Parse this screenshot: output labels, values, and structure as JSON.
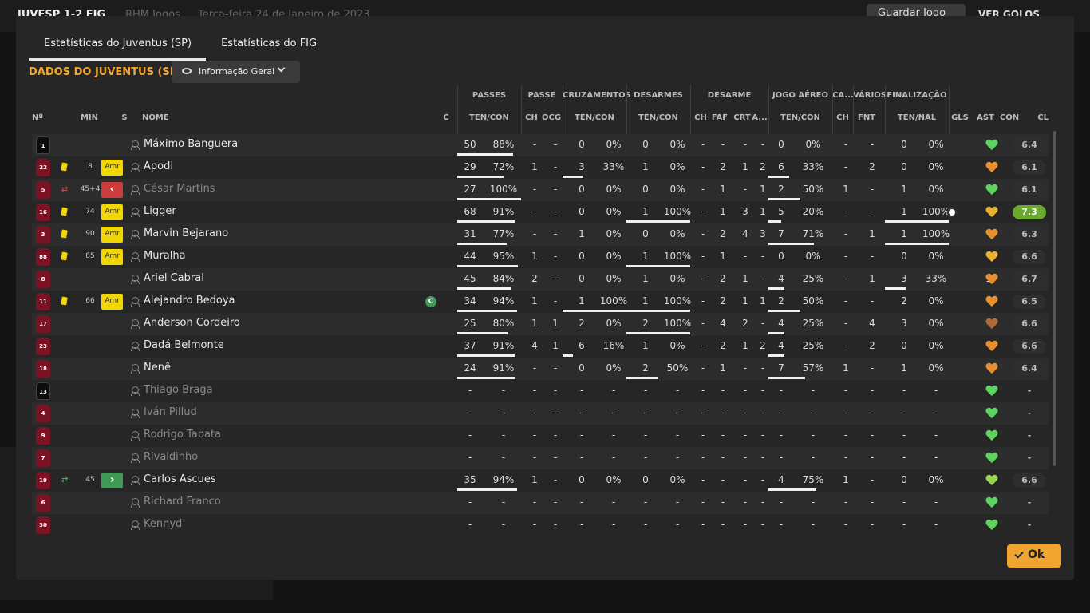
{
  "topbar": {
    "score_text": "JUVESP 1-2 FIG",
    "subtitle": "RHM Jogos",
    "date": "Terça-feira 24 de Janeiro de 2023",
    "save_label": "Guardar Jogo",
    "goals_label": "VER GOLOS"
  },
  "tabs": [
    "Estatísticas do Juventus (SP)",
    "Estatísticas do FIG"
  ],
  "team_title": "DADOS DO JUVENTUS (SP)",
  "view_selector": "Informação Geral",
  "group_headers": [
    "PASSES",
    "PASSE",
    "CRUZAMENTOS",
    "DESARMES",
    "DESARME",
    "JOGO AÉREO",
    "CA...",
    "VÁRIOS",
    "FINALIZAÇÃO"
  ],
  "column_headers": [
    "Nº",
    "MIN",
    "S",
    "NOME",
    "C",
    "TEN/CON",
    "CH",
    "OCG",
    "TEN/CON",
    "TEN/CON",
    "CH",
    "FAF",
    "CRT",
    "A...",
    "TEN/CON",
    "CH",
    "FNT",
    "TEN/NAL",
    "GLS",
    "AST",
    "CON",
    "CLA"
  ],
  "ok_label": "Ok",
  "colors": {
    "accent": "#f0a530",
    "card": "#f2d600",
    "sub_in": "#3f9a55",
    "sub_out": "#cc3c3c",
    "rating_high": "#6aa82e"
  },
  "players": [
    {
      "no": "1",
      "gk": true,
      "name": "Máximo Banguera",
      "card": false,
      "min": "",
      "sub": "",
      "s": "",
      "cap": false,
      "dim": false,
      "pas": [
        "50",
        "88%"
      ],
      "pas_pct": 88,
      "pch": "-",
      "pocg": "-",
      "cru": [
        "0",
        "0%"
      ],
      "cru_pct": 0,
      "des": [
        "0",
        "0%"
      ],
      "des_pct": 0,
      "dch": "-",
      "faf": "-",
      "crt": "-",
      "a": "-",
      "aer": [
        "0",
        "0%"
      ],
      "aer_pct": 0,
      "ca": "-",
      "fnt": "-",
      "fin": [
        "0",
        "0%"
      ],
      "fin_pct": 0,
      "gls": "",
      "ast": "-",
      "con": "#5fd35f",
      "cla": "6.4",
      "hi": false
    },
    {
      "no": "22",
      "gk": false,
      "name": "Apodi",
      "card": true,
      "min": "8",
      "sub": "",
      "s": "Amr",
      "cap": false,
      "dim": false,
      "pas": [
        "29",
        "72%"
      ],
      "pas_pct": 72,
      "pch": "1",
      "pocg": "-",
      "cru": [
        "3",
        "33%"
      ],
      "cru_pct": 33,
      "des": [
        "1",
        "0%"
      ],
      "des_pct": 0,
      "dch": "-",
      "faf": "2",
      "crt": "1",
      "a": "2",
      "aer": [
        "6",
        "33%"
      ],
      "aer_pct": 33,
      "ca": "-",
      "fnt": "2",
      "fin": [
        "0",
        "0%"
      ],
      "fin_pct": 0,
      "gls": "",
      "ast": "-",
      "con": "#e8902f",
      "cla": "6.1",
      "hi": false
    },
    {
      "no": "5",
      "gk": false,
      "name": "César Martins",
      "card": false,
      "min": "45+4",
      "sub": "out",
      "s": "<",
      "cap": false,
      "dim": true,
      "pas": [
        "27",
        "100%"
      ],
      "pas_pct": 100,
      "pch": "-",
      "pocg": "-",
      "cru": [
        "0",
        "0%"
      ],
      "cru_pct": 0,
      "des": [
        "0",
        "0%"
      ],
      "des_pct": 0,
      "dch": "-",
      "faf": "1",
      "crt": "-",
      "a": "1",
      "aer": [
        "2",
        "50%"
      ],
      "aer_pct": 50,
      "ca": "1",
      "fnt": "-",
      "fin": [
        "1",
        "0%"
      ],
      "fin_pct": 0,
      "gls": "",
      "ast": "-",
      "con": "#5fd35f",
      "cla": "6.1",
      "hi": false
    },
    {
      "no": "16",
      "gk": false,
      "name": "Ligger",
      "card": true,
      "min": "74",
      "sub": "",
      "s": "Amr",
      "cap": false,
      "dim": false,
      "pas": [
        "68",
        "91%"
      ],
      "pas_pct": 91,
      "pch": "-",
      "pocg": "-",
      "cru": [
        "0",
        "0%"
      ],
      "cru_pct": 0,
      "des": [
        "1",
        "100%"
      ],
      "des_pct": 100,
      "dch": "-",
      "faf": "1",
      "crt": "3",
      "a": "1",
      "aer": [
        "5",
        "20%"
      ],
      "aer_pct": 20,
      "ca": "-",
      "fnt": "-",
      "fin": [
        "1",
        "100%"
      ],
      "fin_pct": 100,
      "gls": "ball",
      "ast": "-",
      "con": "#e8b02f",
      "cla": "7.3",
      "hi": true
    },
    {
      "no": "3",
      "gk": false,
      "name": "Marvin Bejarano",
      "card": true,
      "min": "90",
      "sub": "",
      "s": "Amr",
      "cap": false,
      "dim": false,
      "pas": [
        "31",
        "77%"
      ],
      "pas_pct": 77,
      "pch": "-",
      "pocg": "-",
      "cru": [
        "1",
        "0%"
      ],
      "cru_pct": 0,
      "des": [
        "0",
        "0%"
      ],
      "des_pct": 0,
      "dch": "-",
      "faf": "2",
      "crt": "4",
      "a": "3",
      "aer": [
        "7",
        "71%"
      ],
      "aer_pct": 71,
      "ca": "-",
      "fnt": "1",
      "fin": [
        "1",
        "100%"
      ],
      "fin_pct": 100,
      "gls": "",
      "ast": "-",
      "con": "#e8902f",
      "cla": "6.3",
      "hi": false
    },
    {
      "no": "88",
      "gk": false,
      "name": "Muralha",
      "card": true,
      "min": "85",
      "sub": "",
      "s": "Amr",
      "cap": false,
      "dim": false,
      "pas": [
        "44",
        "95%"
      ],
      "pas_pct": 95,
      "pch": "1",
      "pocg": "-",
      "cru": [
        "0",
        "0%"
      ],
      "cru_pct": 0,
      "des": [
        "1",
        "100%"
      ],
      "des_pct": 100,
      "dch": "-",
      "faf": "1",
      "crt": "-",
      "a": "-",
      "aer": [
        "0",
        "0%"
      ],
      "aer_pct": 0,
      "ca": "-",
      "fnt": "-",
      "fin": [
        "0",
        "0%"
      ],
      "fin_pct": 0,
      "gls": "",
      "ast": "-",
      "con": "#e8b02f",
      "cla": "6.6",
      "hi": false
    },
    {
      "no": "8",
      "gk": false,
      "name": "Ariel Cabral",
      "card": false,
      "min": "",
      "sub": "",
      "s": "",
      "cap": false,
      "dim": false,
      "pas": [
        "45",
        "84%"
      ],
      "pas_pct": 84,
      "pch": "2",
      "pocg": "-",
      "cru": [
        "0",
        "0%"
      ],
      "cru_pct": 0,
      "des": [
        "1",
        "0%"
      ],
      "des_pct": 0,
      "dch": "-",
      "faf": "2",
      "crt": "1",
      "a": "-",
      "aer": [
        "4",
        "25%"
      ],
      "aer_pct": 25,
      "ca": "-",
      "fnt": "1",
      "fin": [
        "3",
        "33%"
      ],
      "fin_pct": 33,
      "gls": "",
      "ast": "1",
      "con": "#e8902f",
      "cla": "6.7",
      "hi": false
    },
    {
      "no": "11",
      "gk": false,
      "name": "Alejandro Bedoya",
      "card": true,
      "min": "66",
      "sub": "",
      "s": "Amr",
      "cap": true,
      "dim": false,
      "pas": [
        "34",
        "94%"
      ],
      "pas_pct": 94,
      "pch": "1",
      "pocg": "-",
      "cru": [
        "1",
        "100%"
      ],
      "cru_pct": 100,
      "des": [
        "1",
        "100%"
      ],
      "des_pct": 100,
      "dch": "-",
      "faf": "2",
      "crt": "1",
      "a": "1",
      "aer": [
        "2",
        "50%"
      ],
      "aer_pct": 50,
      "ca": "-",
      "fnt": "-",
      "fin": [
        "2",
        "0%"
      ],
      "fin_pct": 0,
      "gls": "",
      "ast": "-",
      "con": "#e8902f",
      "cla": "6.5",
      "hi": false
    },
    {
      "no": "17",
      "gk": false,
      "name": "Anderson Cordeiro",
      "card": false,
      "min": "",
      "sub": "",
      "s": "",
      "cap": false,
      "dim": false,
      "pas": [
        "25",
        "80%"
      ],
      "pas_pct": 80,
      "pch": "1",
      "pocg": "1",
      "cru": [
        "2",
        "0%"
      ],
      "cru_pct": 0,
      "des": [
        "2",
        "100%"
      ],
      "des_pct": 100,
      "dch": "-",
      "faf": "4",
      "crt": "2",
      "a": "-",
      "aer": [
        "4",
        "25%"
      ],
      "aer_pct": 25,
      "ca": "-",
      "fnt": "4",
      "fin": [
        "3",
        "0%"
      ],
      "fin_pct": 0,
      "gls": "",
      "ast": "-",
      "con": "#b06a3a",
      "cla": "6.6",
      "hi": false
    },
    {
      "no": "23",
      "gk": false,
      "name": "Dadá Belmonte",
      "card": false,
      "min": "",
      "sub": "",
      "s": "",
      "cap": false,
      "dim": false,
      "pas": [
        "37",
        "91%"
      ],
      "pas_pct": 91,
      "pch": "4",
      "pocg": "1",
      "cru": [
        "6",
        "16%"
      ],
      "cru_pct": 16,
      "des": [
        "1",
        "0%"
      ],
      "des_pct": 0,
      "dch": "-",
      "faf": "2",
      "crt": "1",
      "a": "2",
      "aer": [
        "4",
        "25%"
      ],
      "aer_pct": 25,
      "ca": "-",
      "fnt": "2",
      "fin": [
        "0",
        "0%"
      ],
      "fin_pct": 0,
      "gls": "",
      "ast": "-",
      "con": "#e8902f",
      "cla": "6.6",
      "hi": false
    },
    {
      "no": "18",
      "gk": false,
      "name": "Nenê",
      "card": false,
      "min": "",
      "sub": "",
      "s": "",
      "cap": false,
      "dim": false,
      "pas": [
        "24",
        "91%"
      ],
      "pas_pct": 91,
      "pch": "-",
      "pocg": "-",
      "cru": [
        "0",
        "0%"
      ],
      "cru_pct": 0,
      "des": [
        "2",
        "50%"
      ],
      "des_pct": 50,
      "dch": "-",
      "faf": "1",
      "crt": "-",
      "a": "-",
      "aer": [
        "7",
        "57%"
      ],
      "aer_pct": 57,
      "ca": "1",
      "fnt": "-",
      "fin": [
        "1",
        "0%"
      ],
      "fin_pct": 0,
      "gls": "",
      "ast": "-",
      "con": "#e8902f",
      "cla": "6.4",
      "hi": false
    },
    {
      "no": "13",
      "gk": true,
      "name": "Thiago Braga",
      "card": false,
      "min": "",
      "sub": "",
      "s": "",
      "cap": false,
      "dim": true,
      "pas": [
        "-",
        "-"
      ],
      "pas_pct": 0,
      "pch": "-",
      "pocg": "-",
      "cru": [
        "-",
        "-"
      ],
      "cru_pct": 0,
      "des": [
        "-",
        "-"
      ],
      "des_pct": 0,
      "dch": "-",
      "faf": "-",
      "crt": "-",
      "a": "-",
      "aer": [
        "-",
        "-"
      ],
      "aer_pct": 0,
      "ca": "-",
      "fnt": "-",
      "fin": [
        "-",
        "-"
      ],
      "fin_pct": 0,
      "gls": "",
      "ast": "-",
      "con": "#5fd35f",
      "cla": "-",
      "hi": false
    },
    {
      "no": "4",
      "gk": false,
      "name": "Iván Pillud",
      "card": false,
      "min": "",
      "sub": "",
      "s": "",
      "cap": false,
      "dim": true,
      "pas": [
        "-",
        "-"
      ],
      "pas_pct": 0,
      "pch": "-",
      "pocg": "-",
      "cru": [
        "-",
        "-"
      ],
      "cru_pct": 0,
      "des": [
        "-",
        "-"
      ],
      "des_pct": 0,
      "dch": "-",
      "faf": "-",
      "crt": "-",
      "a": "-",
      "aer": [
        "-",
        "-"
      ],
      "aer_pct": 0,
      "ca": "-",
      "fnt": "-",
      "fin": [
        "-",
        "-"
      ],
      "fin_pct": 0,
      "gls": "",
      "ast": "-",
      "con": "#5fd35f",
      "cla": "-",
      "hi": false
    },
    {
      "no": "9",
      "gk": false,
      "name": "Rodrigo Tabata",
      "card": false,
      "min": "",
      "sub": "",
      "s": "",
      "cap": false,
      "dim": true,
      "pas": [
        "-",
        "-"
      ],
      "pas_pct": 0,
      "pch": "-",
      "pocg": "-",
      "cru": [
        "-",
        "-"
      ],
      "cru_pct": 0,
      "des": [
        "-",
        "-"
      ],
      "des_pct": 0,
      "dch": "-",
      "faf": "-",
      "crt": "-",
      "a": "-",
      "aer": [
        "-",
        "-"
      ],
      "aer_pct": 0,
      "ca": "-",
      "fnt": "-",
      "fin": [
        "-",
        "-"
      ],
      "fin_pct": 0,
      "gls": "",
      "ast": "-",
      "con": "#5fd35f",
      "cla": "-",
      "hi": false
    },
    {
      "no": "7",
      "gk": false,
      "name": "Rivaldinho",
      "card": false,
      "min": "",
      "sub": "",
      "s": "",
      "cap": false,
      "dim": true,
      "pas": [
        "-",
        "-"
      ],
      "pas_pct": 0,
      "pch": "-",
      "pocg": "-",
      "cru": [
        "-",
        "-"
      ],
      "cru_pct": 0,
      "des": [
        "-",
        "-"
      ],
      "des_pct": 0,
      "dch": "-",
      "faf": "-",
      "crt": "-",
      "a": "-",
      "aer": [
        "-",
        "-"
      ],
      "aer_pct": 0,
      "ca": "-",
      "fnt": "-",
      "fin": [
        "-",
        "-"
      ],
      "fin_pct": 0,
      "gls": "",
      "ast": "-",
      "con": "#5fd35f",
      "cla": "-",
      "hi": false
    },
    {
      "no": "19",
      "gk": false,
      "name": "Carlos Ascues",
      "card": false,
      "min": "45",
      "sub": "in",
      "s": ">",
      "cap": false,
      "dim": false,
      "pas": [
        "35",
        "94%"
      ],
      "pas_pct": 94,
      "pch": "1",
      "pocg": "-",
      "cru": [
        "0",
        "0%"
      ],
      "cru_pct": 0,
      "des": [
        "0",
        "0%"
      ],
      "des_pct": 0,
      "dch": "-",
      "faf": "-",
      "crt": "-",
      "a": "-",
      "aer": [
        "4",
        "75%"
      ],
      "aer_pct": 75,
      "ca": "1",
      "fnt": "-",
      "fin": [
        "0",
        "0%"
      ],
      "fin_pct": 0,
      "gls": "",
      "ast": "-",
      "con": "#9ad34f",
      "cla": "6.6",
      "hi": false
    },
    {
      "no": "6",
      "gk": false,
      "name": "Richard Franco",
      "card": false,
      "min": "",
      "sub": "",
      "s": "",
      "cap": false,
      "dim": true,
      "pas": [
        "-",
        "-"
      ],
      "pas_pct": 0,
      "pch": "-",
      "pocg": "-",
      "cru": [
        "-",
        "-"
      ],
      "cru_pct": 0,
      "des": [
        "-",
        "-"
      ],
      "des_pct": 0,
      "dch": "-",
      "faf": "-",
      "crt": "-",
      "a": "-",
      "aer": [
        "-",
        "-"
      ],
      "aer_pct": 0,
      "ca": "-",
      "fnt": "-",
      "fin": [
        "-",
        "-"
      ],
      "fin_pct": 0,
      "gls": "",
      "ast": "-",
      "con": "#5fd35f",
      "cla": "-",
      "hi": false
    },
    {
      "no": "30",
      "gk": false,
      "name": "Kennyd",
      "card": false,
      "min": "",
      "sub": "",
      "s": "",
      "cap": false,
      "dim": true,
      "pas": [
        "-",
        "-"
      ],
      "pas_pct": 0,
      "pch": "-",
      "pocg": "-",
      "cru": [
        "-",
        "-"
      ],
      "cru_pct": 0,
      "des": [
        "-",
        "-"
      ],
      "des_pct": 0,
      "dch": "-",
      "faf": "-",
      "crt": "-",
      "a": "-",
      "aer": [
        "-",
        "-"
      ],
      "aer_pct": 0,
      "ca": "-",
      "fnt": "-",
      "fin": [
        "-",
        "-"
      ],
      "fin_pct": 0,
      "gls": "",
      "ast": "-",
      "con": "#5fd35f",
      "cla": "-",
      "hi": false
    }
  ]
}
